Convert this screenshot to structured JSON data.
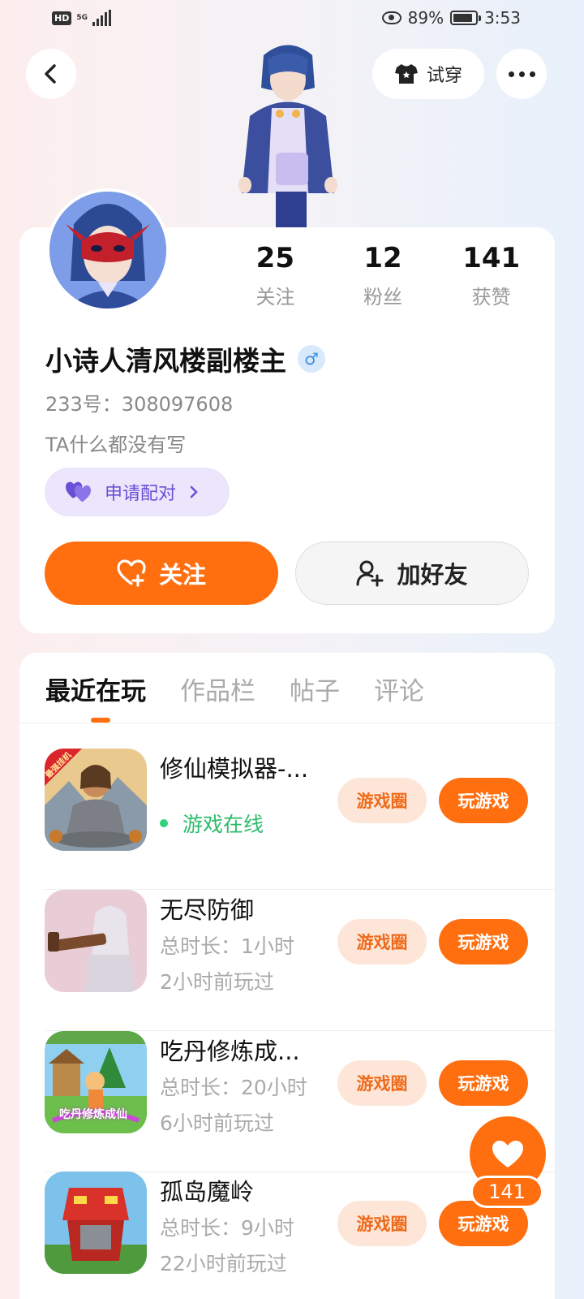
{
  "status_bar": {
    "network_badge": "HD",
    "network_type": "5G",
    "battery_percent": "89%",
    "time": "3:53",
    "battery_level": 0.89
  },
  "header": {
    "tryon_label": "试穿"
  },
  "profile": {
    "stats": [
      {
        "value": "25",
        "label": "关注"
      },
      {
        "value": "12",
        "label": "粉丝"
      },
      {
        "value": "141",
        "label": "获赞"
      }
    ],
    "username": "小诗人清风楼副楼主",
    "gender_symbol": "♂",
    "uid_text": "233号：308097608",
    "bio": "TA什么都没有写",
    "pair_label": "申请配对",
    "follow_label": "关注",
    "add_friend_label": "加好友"
  },
  "tabs": [
    {
      "label": "最近在玩"
    },
    {
      "label": "作品栏"
    },
    {
      "label": "帖子"
    },
    {
      "label": "评论"
    }
  ],
  "games": [
    {
      "title": "修仙模拟器-...",
      "status": "游戏在线",
      "circle_label": "游戏圈",
      "play_label": "玩游戏",
      "thumb_tag": "最强挂机"
    },
    {
      "title": "无尽防御",
      "duration": "总时长：1小时",
      "last_played": "2小时前玩过",
      "circle_label": "游戏圈",
      "play_label": "玩游戏"
    },
    {
      "title": "吃丹修炼成...",
      "duration": "总时长：20小时",
      "last_played": "6小时前玩过",
      "circle_label": "游戏圈",
      "play_label": "玩游戏",
      "thumb_text": "吃丹修炼成仙"
    },
    {
      "title": "孤岛魔岭",
      "duration": "总时长：9小时",
      "last_played": "22小时前玩过",
      "circle_label": "游戏圈",
      "play_label": "玩游戏"
    }
  ],
  "like_fab": {
    "count": "141"
  },
  "colors": {
    "accent": "#ff6f10",
    "online": "#2dbb6a",
    "pair": "#6a4fd6"
  }
}
